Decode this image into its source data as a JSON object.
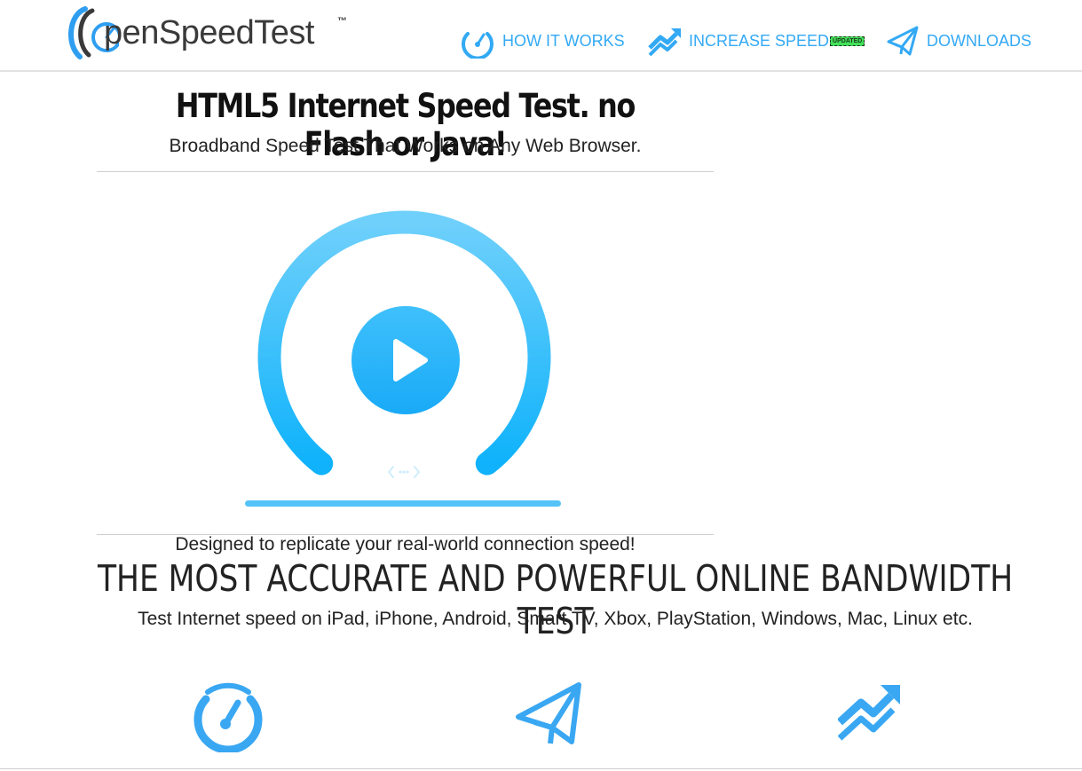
{
  "brand": {
    "name": "OpenSpeedTest",
    "name_rest": "penSpeedTest",
    "trademark": "™",
    "color": "#2f9ef0"
  },
  "nav": {
    "items": [
      {
        "label": "HOW IT WORKS",
        "icon": "speedometer-icon"
      },
      {
        "label": "INCREASE SPEED",
        "badge": "UPDATED",
        "icon": "trending-up-arrow-icon"
      },
      {
        "label": "DOWNLOADS",
        "icon": "paper-plane-icon"
      }
    ],
    "color": "#33a9f4"
  },
  "hero": {
    "title": "HTML5 Internet Speed Test. no Flash or Java!",
    "subtitle": "Broadband Speed Test That Works on Any Web Browser."
  },
  "gauge": {
    "start_button_icon": "play-icon",
    "connection_icon": "connection-arrows-icon",
    "gradient_top": "#6fd0fb",
    "gradient_bottom": "#0fb2fb"
  },
  "tagline": "Designed to replicate your real-world connection speed!",
  "headline": "THE MOST ACCURATE AND POWERFUL ONLINE BANDWIDTH TEST",
  "devices": "Test Internet speed on iPad, iPhone, Android, Smart TV, Xbox, PlayStation, Windows, Mac, Linux etc.",
  "features": [
    {
      "icon": "speedometer-icon"
    },
    {
      "icon": "paper-plane-icon"
    },
    {
      "icon": "trending-up-arrow-icon"
    }
  ],
  "accent": "#3aa7f2"
}
